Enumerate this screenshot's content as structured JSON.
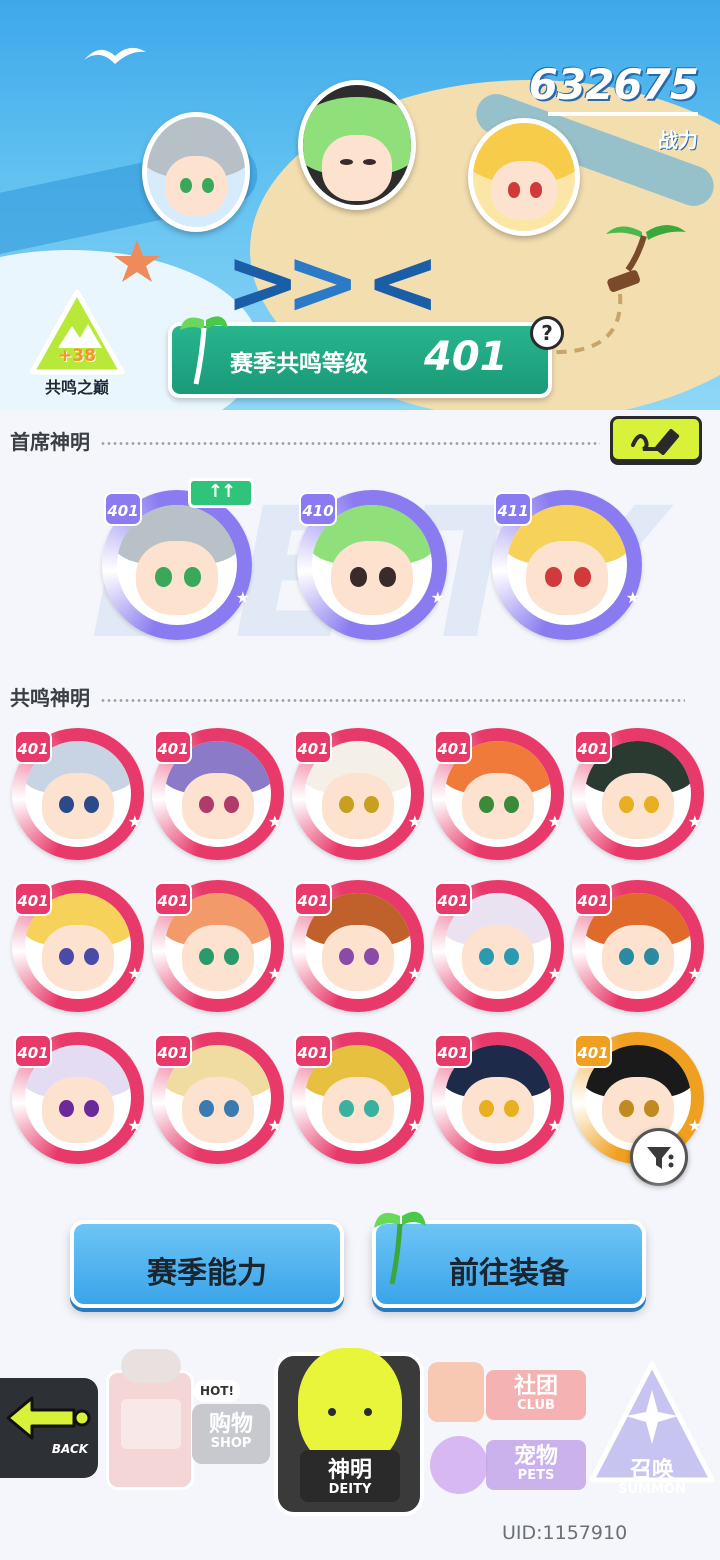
{
  "header": {
    "power_value": "632675",
    "power_label": "战力",
    "peak_bonus": "+38",
    "peak_label": "共鸣之巅",
    "season_label": "赛季共鸣等级",
    "season_level": "401",
    "help_glyph": "?"
  },
  "head_deities": {
    "title": "首席神明",
    "upgrade_glyph": "↑↑",
    "watermark": "DEITY",
    "items": [
      {
        "level": "401",
        "ring": "#8a7cf0",
        "hair": "#b8c0c8",
        "eye": "#3aa85a"
      },
      {
        "level": "410",
        "ring": "#8a7cf0",
        "hair": "#8fe07a",
        "eye": "#3a2a2a"
      },
      {
        "level": "411",
        "ring": "#8a7cf0",
        "hair": "#f7d25a",
        "eye": "#d03a3a"
      }
    ]
  },
  "resonance_deities": {
    "title": "共鸣神明",
    "items": [
      {
        "level": "401",
        "ring": "#e83a6a",
        "hair": "#c8d4e4",
        "eye": "#2a4a8a"
      },
      {
        "level": "401",
        "ring": "#e83a6a",
        "hair": "#8a7ac8",
        "eye": "#b03a6a"
      },
      {
        "level": "401",
        "ring": "#e83a6a",
        "hair": "#f4f0e8",
        "eye": "#c8a020"
      },
      {
        "level": "401",
        "ring": "#e83a6a",
        "hair": "#f07a3a",
        "eye": "#3a8a3a"
      },
      {
        "level": "401",
        "ring": "#e83a6a",
        "hair": "#2a3a30",
        "eye": "#e8b020"
      },
      {
        "level": "401",
        "ring": "#e83a6a",
        "hair": "#f7d25a",
        "eye": "#4a4aa8"
      },
      {
        "level": "401",
        "ring": "#e83a6a",
        "hair": "#f29a6a",
        "eye": "#2a9a6a"
      },
      {
        "level": "401",
        "ring": "#e83a6a",
        "hair": "#c0602a",
        "eye": "#8a4aa8"
      },
      {
        "level": "401",
        "ring": "#e83a6a",
        "hair": "#eae2f0",
        "eye": "#2a9ab0"
      },
      {
        "level": "401",
        "ring": "#e83a6a",
        "hair": "#e06a2a",
        "eye": "#2a8aa0"
      },
      {
        "level": "401",
        "ring": "#e83a6a",
        "hair": "#e4dcf2",
        "eye": "#6a2a9a"
      },
      {
        "level": "401",
        "ring": "#e83a6a",
        "hair": "#f0dca0",
        "eye": "#3a7ab0"
      },
      {
        "level": "401",
        "ring": "#e83a6a",
        "hair": "#e8c040",
        "eye": "#3ab0a0"
      },
      {
        "level": "401",
        "ring": "#e83a6a",
        "hair": "#1e2a4a",
        "eye": "#e8b020"
      },
      {
        "level": "401",
        "ring": "#f0a020",
        "hair": "#1a1a1a",
        "eye": "#c08a20"
      }
    ]
  },
  "actions": {
    "season_ability": "赛季能力",
    "go_equip": "前往装备"
  },
  "nav": {
    "back_en": "BACK",
    "shop_badge": "HOT!",
    "shop_cn": "购物",
    "shop_en": "SHOP",
    "deity_cn": "神明",
    "deity_en": "DEITY",
    "club_cn": "社团",
    "club_en": "CLUB",
    "pets_cn": "宠物",
    "pets_en": "PETS",
    "summon_cn": "召唤",
    "summon_en": "SUMMON"
  },
  "footer": {
    "uid": "UID:1157910"
  },
  "colors": {
    "accent_lime": "#d8f23a",
    "season_green": "#1fa883",
    "action_blue": "#4ab0ee",
    "deity_ring_purple": "#8a7cf0",
    "resonance_ring_pink": "#e83a6a"
  }
}
